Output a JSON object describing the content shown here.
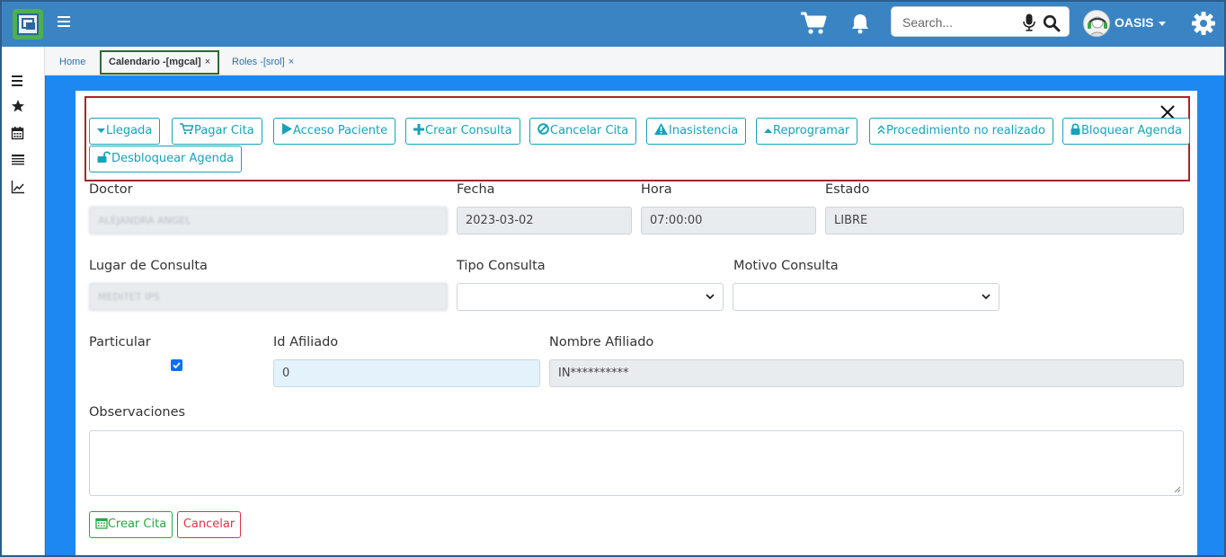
{
  "navbar": {
    "search_placeholder": "Search...",
    "user_name": "OASIS",
    "icons": [
      "app-logo",
      "menu-icon",
      "cart-icon",
      "bell-icon",
      "mic-icon",
      "search-icon",
      "avatar",
      "gear-icon"
    ]
  },
  "sidebar": {
    "icons": [
      "list-icon",
      "star-icon",
      "calendar-icon",
      "table-icon",
      "chart-icon"
    ]
  },
  "tabs": [
    {
      "label": "Home",
      "closable": false
    },
    {
      "label": "Calendario -[mgcal]",
      "closable": true,
      "close": "×"
    },
    {
      "label": "Roles -[srol]",
      "closable": true,
      "close": "×"
    }
  ],
  "actions": [
    {
      "label": "Llegada",
      "icon": "caret-down-icon"
    },
    {
      "label": "Pagar Cita",
      "icon": "cart-icon"
    },
    {
      "label": "Acceso Paciente",
      "icon": "play-icon"
    },
    {
      "label": "Crear Consulta",
      "icon": "plus-icon"
    },
    {
      "label": "Cancelar Cita",
      "icon": "ban-icon"
    },
    {
      "label": "Inasistencia",
      "icon": "warning-icon"
    },
    {
      "label": "Reprogramar",
      "icon": "caret-up-icon"
    },
    {
      "label": "Procedimiento no realizado",
      "icon": "double-chevron-up-icon"
    },
    {
      "label": "Bloquear Agenda",
      "icon": "lock-icon"
    },
    {
      "label": "Desbloquear Agenda",
      "icon": "unlock-icon"
    }
  ],
  "form": {
    "doctor": {
      "label": "Doctor",
      "value": "ALEJANDRA ANGEL"
    },
    "fecha": {
      "label": "Fecha",
      "value": "2023-03-02"
    },
    "hora": {
      "label": "Hora",
      "value": "07:00:00"
    },
    "estado": {
      "label": "Estado",
      "value": "LIBRE"
    },
    "lugar": {
      "label": "Lugar de Consulta",
      "value": "MEDITET IPS"
    },
    "tipo": {
      "label": "Tipo Consulta",
      "value": ""
    },
    "motivo": {
      "label": "Motivo Consulta",
      "value": ""
    },
    "particular": {
      "label": "Particular",
      "checked": true
    },
    "id_afiliado": {
      "label": "Id Afiliado",
      "value": "0"
    },
    "nombre_afiliado": {
      "label": "Nombre Afiliado",
      "value": "IN**********"
    },
    "observaciones": {
      "label": "Observaciones",
      "value": ""
    }
  },
  "footer_buttons": {
    "crear": "Crear Cita",
    "cancelar": "Cancelar"
  },
  "colors": {
    "navbar": "#3a84c4",
    "content_bg": "#1e88f2",
    "info": "#17a2b8",
    "success": "#28a745",
    "danger": "#dc3545",
    "highlight_box": "#a4262c"
  }
}
